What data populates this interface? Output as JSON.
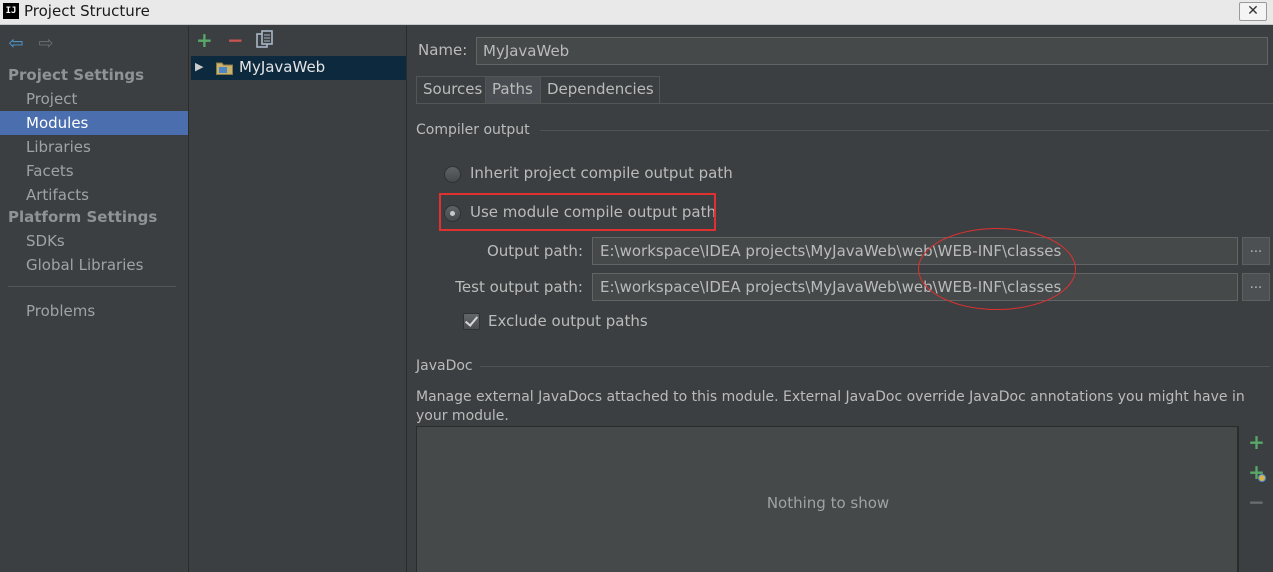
{
  "window": {
    "title": "Project Structure",
    "app_icon_text": "IJ",
    "close_glyph": "✕"
  },
  "nav": {
    "back_glyph": "⇦",
    "forward_glyph": "⇨",
    "project_settings_header": "Project Settings",
    "project_settings_items": [
      "Project",
      "Modules",
      "Libraries",
      "Facets",
      "Artifacts"
    ],
    "platform_settings_header": "Platform Settings",
    "platform_settings_items": [
      "SDKs",
      "Global Libraries"
    ],
    "problems_label": "Problems",
    "selected_item": "Modules",
    "selected_color": "#4b6eaf"
  },
  "tree": {
    "add_glyph": "+",
    "remove_glyph": "−",
    "expand_glyph": "▶",
    "module_name": "MyJavaWeb"
  },
  "module": {
    "name_label": "Name:",
    "name_value": "MyJavaWeb",
    "tabs": [
      "Sources",
      "Paths",
      "Dependencies"
    ],
    "active_tab": "Paths"
  },
  "compiler_output": {
    "title": "Compiler output",
    "option_inherit": "Inherit project compile output path",
    "option_module": "Use module compile output path",
    "selected_option": "Use module compile output path",
    "output_path_label": "Output path:",
    "output_path_value": "E:\\workspace\\IDEA projects\\MyJavaWeb\\web\\WEB-INF\\classes",
    "test_output_path_label": "Test output path:",
    "test_output_path_value": "E:\\workspace\\IDEA projects\\MyJavaWeb\\web\\WEB-INF\\classes",
    "browse_label": "...",
    "exclude_label": "Exclude output paths",
    "exclude_checked": true,
    "highlight_color": "#e03030"
  },
  "javadoc": {
    "title": "JavaDoc",
    "description": "Manage external JavaDocs attached to this module. External JavaDoc override JavaDoc annotations you might have in your module.",
    "empty_text": "Nothing to show",
    "add_glyph": "+",
    "remove_glyph": "−"
  }
}
